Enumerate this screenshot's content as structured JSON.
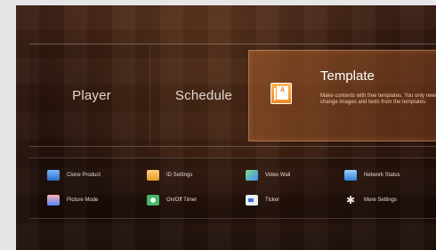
{
  "main_menu": {
    "player_label": "Player",
    "schedule_label": "Schedule",
    "template": {
      "title": "Template",
      "description": "Make contents with free templates. You only need to change images and texts from the templates.",
      "icon_letter": "A"
    }
  },
  "options": [
    {
      "label": "Clone Product",
      "icon": "clone-product-icon"
    },
    {
      "label": "ID Settings",
      "icon": "id-settings-icon"
    },
    {
      "label": "Video Wall",
      "icon": "video-wall-icon"
    },
    {
      "label": "Network Status",
      "icon": "network-status-icon"
    },
    {
      "label": "Picture Mode",
      "icon": "picture-mode-icon"
    },
    {
      "label": "On/Off Timer",
      "icon": "timer-icon"
    },
    {
      "label": "Ticker",
      "icon": "ticker-icon"
    },
    {
      "label": "More Settings",
      "icon": "gear-icon"
    }
  ],
  "colors": {
    "background": "#2a140c",
    "template_accent": "#b0652d",
    "text": "#e4d7cf"
  }
}
